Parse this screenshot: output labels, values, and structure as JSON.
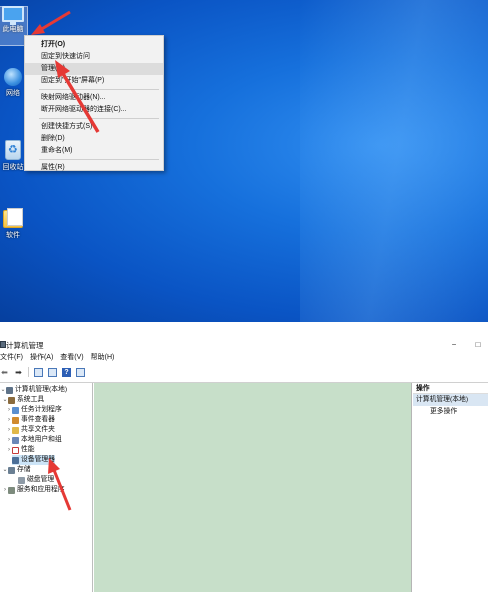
{
  "desktop": {
    "icons": [
      {
        "label": "此电脑"
      },
      {
        "label": "网络"
      },
      {
        "label": "回收站"
      },
      {
        "label": "软件"
      }
    ],
    "context_menu": {
      "items": [
        {
          "label": "打开(O)"
        },
        {
          "label": "固定到快速访问"
        },
        {
          "label": "管理(G)"
        },
        {
          "label": "固定到\"开始\"屏幕(P)"
        },
        {
          "label": "映射网络驱动器(N)..."
        },
        {
          "label": "断开网络驱动器的连接(C)..."
        },
        {
          "label": "创建快捷方式(S)"
        },
        {
          "label": "删除(D)"
        },
        {
          "label": "重命名(M)"
        },
        {
          "label": "属性(R)"
        }
      ]
    }
  },
  "window": {
    "title": "计算机管理",
    "controls": {
      "minimize": "−",
      "maximize": "□"
    },
    "menu": [
      "文件(F)",
      "操作(A)",
      "查看(V)",
      "帮助(H)"
    ],
    "toolbar_icons": [
      "back-arrow-icon",
      "forward-arrow-icon",
      "show-hide-tree-icon",
      "properties-icon",
      "help-icon",
      "panel-icon"
    ],
    "tree": {
      "root": "计算机管理(本地)",
      "system_tools": "系统工具",
      "task_scheduler": "任务计划程序",
      "event_viewer": "事件查看器",
      "shared_folders": "共享文件夹",
      "local_users": "本地用户和组",
      "performance": "性能",
      "device_manager": "设备管理器",
      "storage": "存储",
      "disk_management": "磁盘管理",
      "services": "服务和应用程序"
    },
    "actions": {
      "header": "操作",
      "title": "计算机管理(本地)",
      "more": "更多操作"
    }
  },
  "colors": {
    "desktop_blue": "#0a54c4",
    "center_pane": "#c7dfc9",
    "annotation_arrow": "#e53935"
  }
}
